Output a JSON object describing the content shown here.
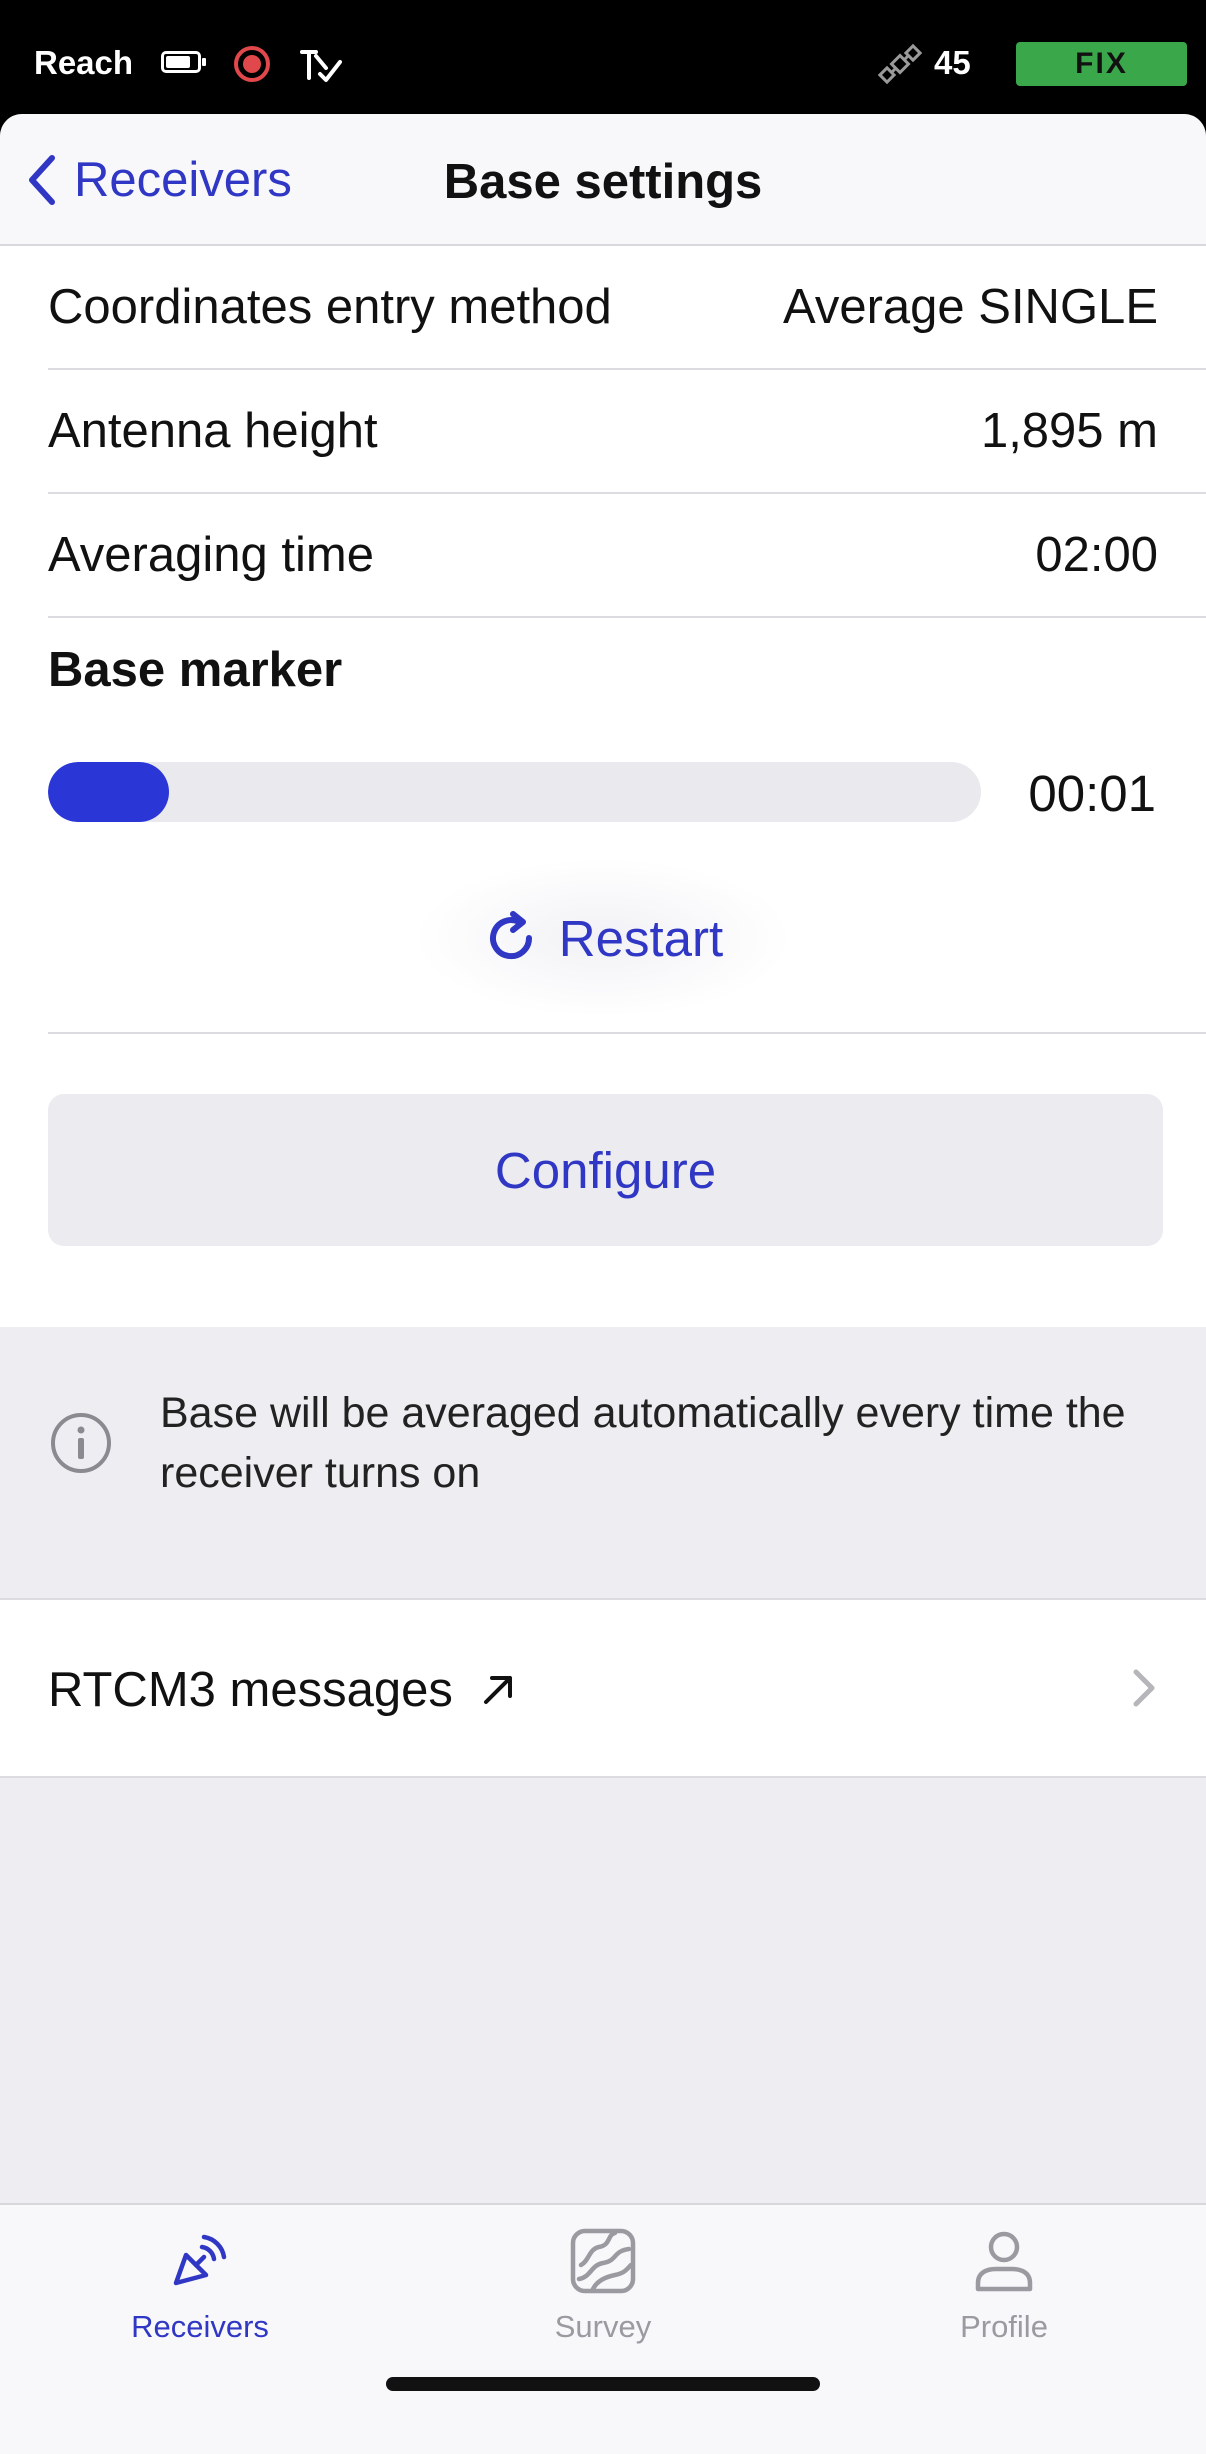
{
  "status_bar": {
    "carrier": "Reach",
    "satellite_count": "45",
    "fix_status": "FIX",
    "fix_color": "#3aa84a",
    "icons": [
      "battery-icon",
      "record-icon",
      "tools-icon",
      "satellite-icon"
    ]
  },
  "nav": {
    "back_label": "Receivers",
    "title": "Base settings"
  },
  "settings": {
    "rows": [
      {
        "label": "Coordinates entry method",
        "value": "Average SINGLE"
      },
      {
        "label": "Antenna height",
        "value": "1,895 m"
      },
      {
        "label": "Averaging time",
        "value": "02:00"
      }
    ]
  },
  "base_marker": {
    "title": "Base marker",
    "progress": 0.13,
    "elapsed": "00:01",
    "restart_label": "Restart",
    "configure_label": "Configure"
  },
  "info": {
    "text": "Base will be averaged automatically every time the receiver turns on"
  },
  "rtcm": {
    "label": "RTCM3 messages"
  },
  "tabbar": {
    "items": [
      {
        "label": "Receivers",
        "icon": "receivers-icon",
        "active": true
      },
      {
        "label": "Survey",
        "icon": "survey-icon",
        "active": false
      },
      {
        "label": "Profile",
        "icon": "profile-icon",
        "active": false
      }
    ]
  },
  "colors": {
    "accent": "#2f37c4",
    "progress": "#2a36d6",
    "background": "#ededf2"
  }
}
